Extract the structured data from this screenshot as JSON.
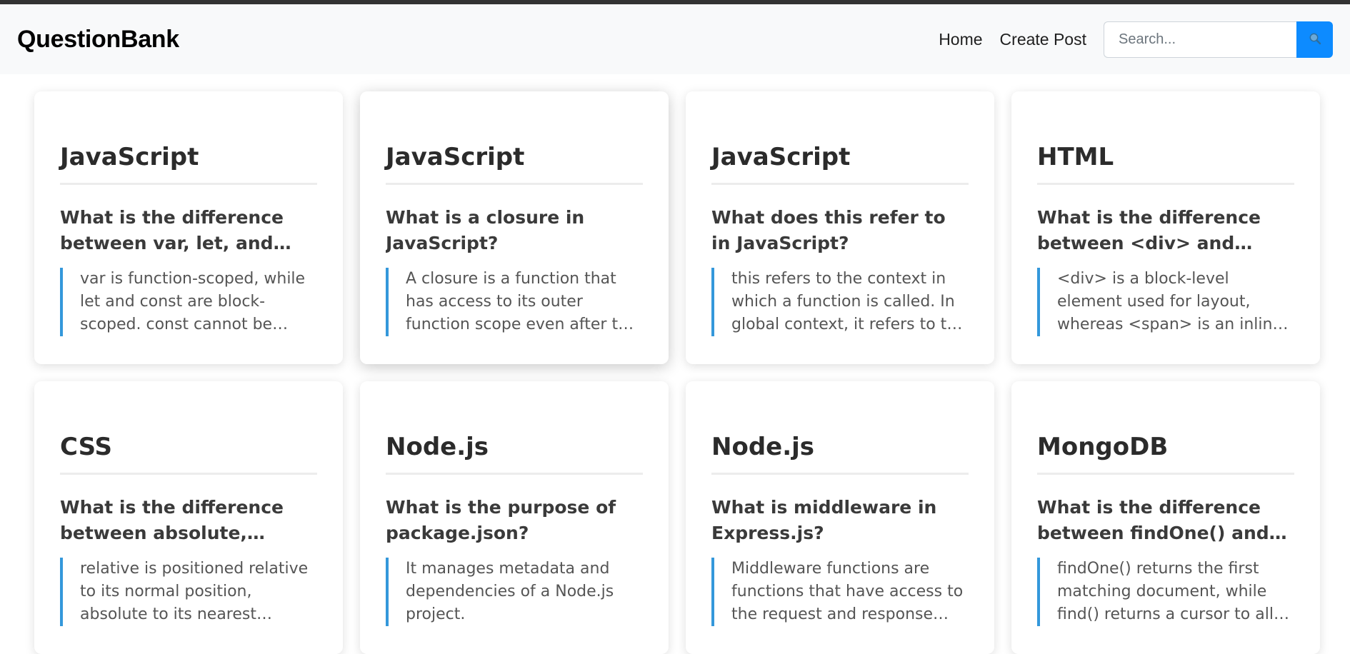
{
  "navbar": {
    "brand": "QuestionBank",
    "links": [
      "Home",
      "Create Post"
    ],
    "search_placeholder": "Search...",
    "search_icon": "search-icon",
    "accent_color": "#0d8bff"
  },
  "cards": [
    {
      "topic": "JavaScript",
      "question": "What is the difference between var, let, and const in JavaScript?",
      "answer": "var is function-scoped, while let and const are block-scoped. const cannot be reassigned, while let can be updated."
    },
    {
      "topic": "JavaScript",
      "question": "What is a closure in JavaScript?",
      "answer": "A closure is a function that has access to its outer function scope even after the outer function has returned."
    },
    {
      "topic": "JavaScript",
      "question": "What does this refer to in JavaScript?",
      "answer": "this refers to the context in which a function is called. In global context, it refers to the global object."
    },
    {
      "topic": "HTML",
      "question": "What is the difference between <div> and <span>?",
      "answer": "<div> is a block-level element used for layout, whereas <span> is an inline element used for styling text."
    },
    {
      "topic": "CSS",
      "question": "What is the difference between absolute, relative, fixed and sticky positioning?",
      "answer": "relative is positioned relative to its normal position, absolute to its nearest positioned ancestor, fixed to the viewport."
    },
    {
      "topic": "Node.js",
      "question": "What is the purpose of package.json?",
      "answer": "It manages metadata and dependencies of a Node.js project."
    },
    {
      "topic": "Node.js",
      "question": "What is middleware in Express.js?",
      "answer": "Middleware functions are functions that have access to the request and response objects in the application."
    },
    {
      "topic": "MongoDB",
      "question": "What is the difference between findOne() and find() in MongoDB?",
      "answer": "findOne() returns the first matching document, while find() returns a cursor to all matching documents."
    }
  ]
}
